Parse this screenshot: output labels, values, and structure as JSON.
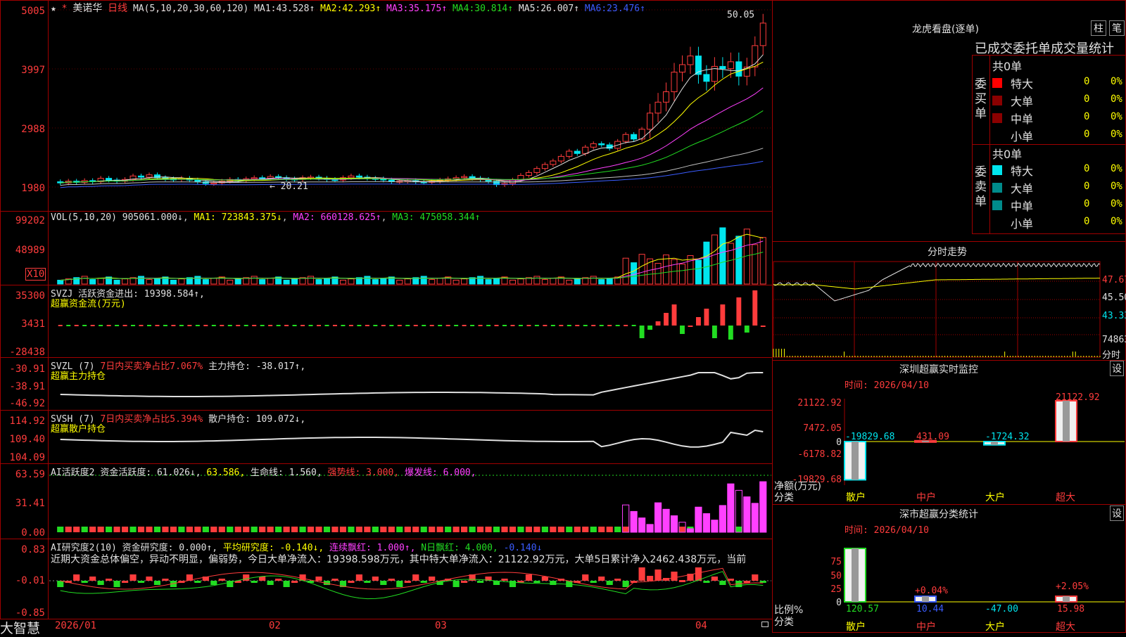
{
  "stock": {
    "name": "美诺华",
    "period": "日线",
    "star": "★",
    "tag": "*"
  },
  "colors": {
    "up": "#ff3c3c",
    "down": "#00e5ee",
    "grid": "#a00000",
    "ma1": "#e0e0e0",
    "ma2": "#ffff00",
    "ma3": "#ff40ff",
    "ma4": "#22dd22",
    "ma5": "#c0c0c0",
    "ma6": "#3a5cff"
  },
  "main": {
    "ma_label": "MA(5,10,20,30,60,120)",
    "ma": [
      {
        "label": "MA1:",
        "value": "43.528↑"
      },
      {
        "label": "MA2:",
        "value": "42.293↑"
      },
      {
        "label": "MA3:",
        "value": "35.175↑"
      },
      {
        "label": "MA4:",
        "value": "30.814↑"
      },
      {
        "label": "MA5:",
        "value": "26.007↑"
      },
      {
        "label": "MA6:",
        "value": "23.476↑"
      }
    ],
    "y_ticks": [
      "5005",
      "3997",
      "2988",
      "1980"
    ],
    "high_marker": "50.05",
    "low_marker": "← 20.21"
  },
  "vol": {
    "label": "VOL(5,10,20)",
    "value": "905061.000↓",
    "ma1": "MA1: 723843.375↓",
    "ma2": "MA2: 660128.625↑",
    "ma3": "MA3: 475058.344↑",
    "y_ticks": [
      "99202",
      "48989"
    ],
    "unit": "X10"
  },
  "svzj": {
    "label": "SVZJ",
    "l1": "活跃资金进出: 19398.584↑,",
    "l2": "超赢资金流(万元)",
    "y_ticks": [
      "35300",
      "3431",
      "-28438"
    ]
  },
  "svzl": {
    "label": "SVZL (7)",
    "l1": "7日内买卖净占比7.067%",
    "l2": "主力持仓: -38.017↑,",
    "l3": "超赢主力持仓",
    "y_ticks": [
      "-30.91",
      "-38.91",
      "-46.92"
    ]
  },
  "svsh": {
    "label": "SVSH (7)",
    "l1": "7日内买卖净占比5.394%",
    "l2": "散户持仓: 109.072↓,",
    "l3": "超赢散户持仓",
    "y_ticks": [
      "114.92",
      "109.40",
      "104.09"
    ]
  },
  "ai1": {
    "label": "AI活跃度2",
    "l1": "资金活跃度: 61.026↓,",
    "l2": "63.586,",
    "l3": "生命线: 1.560,",
    "l4": "强势线: 3.000,",
    "l5": "爆发线: 6.000,",
    "y_ticks": [
      "63.59",
      "31.41",
      "0.00"
    ]
  },
  "ai2": {
    "label": "AI研究度2(10)",
    "l1": "资金研究度: 0.000↑,",
    "l2": "平均研究度: -0.140↓,",
    "l3": "连续飘红: 1.000↑,",
    "l4": "N日飘红: 4.000,",
    "l5": "-0.140↓",
    "y_ticks": [
      "0.83",
      "-0.01",
      "-0.85"
    ],
    "text": "近期大资金总体偏空，异动不明显，偏弱势，今日大单净流入：19398.598万元，其中特大单净流入：21122.92万元，大单5日累计净入2462.438万元，当前"
  },
  "xaxis": {
    "brand": "大智慧",
    "labels": [
      "2026/01",
      "02",
      "03",
      "04"
    ]
  },
  "right": {
    "lhkp": {
      "title": "龙虎看盘(逐单)",
      "btn1": "柱",
      "btn2": "笔",
      "header": "已成交委托单成交量统计",
      "buy": {
        "side": "委买单",
        "total": "共0单",
        "rows": [
          {
            "name": "特大",
            "qty": "0",
            "pct": "0%"
          },
          {
            "name": "大单",
            "qty": "0",
            "pct": "0%"
          },
          {
            "name": "中单",
            "qty": "0",
            "pct": "0%"
          },
          {
            "name": "小单",
            "qty": "0",
            "pct": "0%"
          }
        ]
      },
      "sell": {
        "side": "委卖单",
        "total": "共0单",
        "rows": [
          {
            "name": "特大",
            "qty": "0",
            "pct": "0%"
          },
          {
            "name": "大单",
            "qty": "0",
            "pct": "0%"
          },
          {
            "name": "中单",
            "qty": "0",
            "pct": "0%"
          },
          {
            "name": "小单",
            "qty": "0",
            "pct": "0%"
          }
        ]
      }
    },
    "fst": {
      "title": "分时走势",
      "y_ticks": [
        "47.67",
        "45.50",
        "43.33",
        "74863"
      ],
      "xl": "分时"
    },
    "szmon": {
      "title": "深圳超赢实时监控",
      "btn": "设",
      "time": "时间: 2026/04/10",
      "y_ticks": [
        "21122.92",
        "7472.05",
        "0",
        "-6178.82",
        "-19829.68"
      ],
      "ylab1": "净额(万元)",
      "ylab2": "分类",
      "cats": [
        "散户",
        "中户",
        "大户",
        "超大"
      ],
      "values": [
        -19829.68,
        431.09,
        -1724.32,
        21122.92
      ],
      "value_labels": [
        "-19829.68",
        "431.09",
        "-1724.32",
        "21122.92"
      ]
    },
    "szstat": {
      "title": "深市超赢分类统计",
      "btn": "设",
      "time": "时间: 2026/04/10",
      "y_ticks": [
        "75",
        "50",
        "25",
        "0"
      ],
      "ylab1": "比例%",
      "ylab2": "分类",
      "cats": [
        "散户",
        "中户",
        "大户",
        "超大"
      ],
      "bottom_vals": [
        "120.57",
        "10.44",
        "-47.00",
        "15.98"
      ],
      "pct_labels": [
        "",
        "+0.04%",
        "",
        "+2.05%"
      ],
      "values": [
        120.57,
        10.44,
        -47.0,
        15.98
      ]
    }
  },
  "chart_data": [
    {
      "type": "candlestick",
      "title": "美诺华 日线",
      "y_ticks": [
        50.05,
        39.97,
        29.88,
        19.8
      ],
      "ylim": [
        19.8,
        50.05
      ],
      "high": 50.05,
      "low": 20.21,
      "moving_averages": {
        "MA1": 43.528,
        "MA2": 42.293,
        "MA3": 35.175,
        "MA4": 30.814,
        "MA5": 26.007,
        "MA6": 23.476
      },
      "x_labels": [
        "2026/01",
        "02",
        "03",
        "04"
      ],
      "close": [
        21.0,
        21.3,
        21.1,
        21.4,
        21.2,
        21.8,
        21.5,
        21.3,
        21.6,
        22.2,
        22.0,
        22.4,
        21.9,
        21.7,
        21.6,
        21.8,
        21.5,
        21.2,
        20.9,
        21.0,
        21.3,
        21.6,
        21.4,
        21.7,
        21.9,
        21.8,
        22.1,
        21.9,
        21.7,
        21.6,
        21.9,
        22.0,
        21.8,
        21.6,
        21.5,
        21.9,
        22.2,
        22.0,
        21.8,
        21.7,
        21.5,
        21.2,
        21.3,
        21.4,
        21.2,
        21.1,
        21.3,
        21.5,
        21.7,
        21.9,
        22.1,
        21.8,
        21.6,
        21.3,
        20.7,
        20.9,
        21.5,
        22.3,
        22.8,
        23.5,
        24.2,
        24.8,
        25.6,
        26.5,
        26.1,
        27.2,
        27.8,
        27.6,
        27.0,
        28.2,
        29.4,
        28.6,
        30.3,
        33.1,
        35.0,
        36.8,
        40.2,
        41.5,
        43.0,
        39.8,
        38.6,
        41.2,
        40.8,
        42.0,
        39.5,
        41.1,
        44.8,
        48.7
      ],
      "open": [
        21.2,
        21.0,
        21.3,
        21.1,
        21.4,
        21.2,
        21.8,
        21.5,
        21.3,
        21.6,
        22.2,
        22.0,
        22.4,
        21.9,
        21.7,
        21.6,
        21.8,
        21.5,
        21.2,
        20.9,
        21.0,
        21.3,
        21.6,
        21.4,
        21.7,
        21.9,
        21.8,
        22.1,
        21.9,
        21.7,
        21.6,
        21.9,
        22.0,
        21.8,
        21.6,
        21.5,
        21.9,
        22.2,
        22.0,
        21.8,
        21.7,
        21.5,
        21.2,
        21.3,
        21.4,
        21.2,
        21.1,
        21.3,
        21.5,
        21.7,
        21.9,
        22.1,
        21.8,
        21.6,
        21.3,
        20.7,
        20.9,
        21.5,
        22.3,
        22.8,
        23.5,
        24.2,
        24.8,
        25.6,
        26.5,
        26.1,
        27.2,
        27.8,
        27.6,
        27.0,
        28.2,
        29.4,
        28.6,
        30.3,
        33.1,
        35.0,
        36.8,
        40.2,
        41.5,
        43.0,
        39.8,
        38.6,
        41.2,
        40.8,
        42.0,
        39.5,
        41.1,
        44.8
      ]
    }
  ]
}
